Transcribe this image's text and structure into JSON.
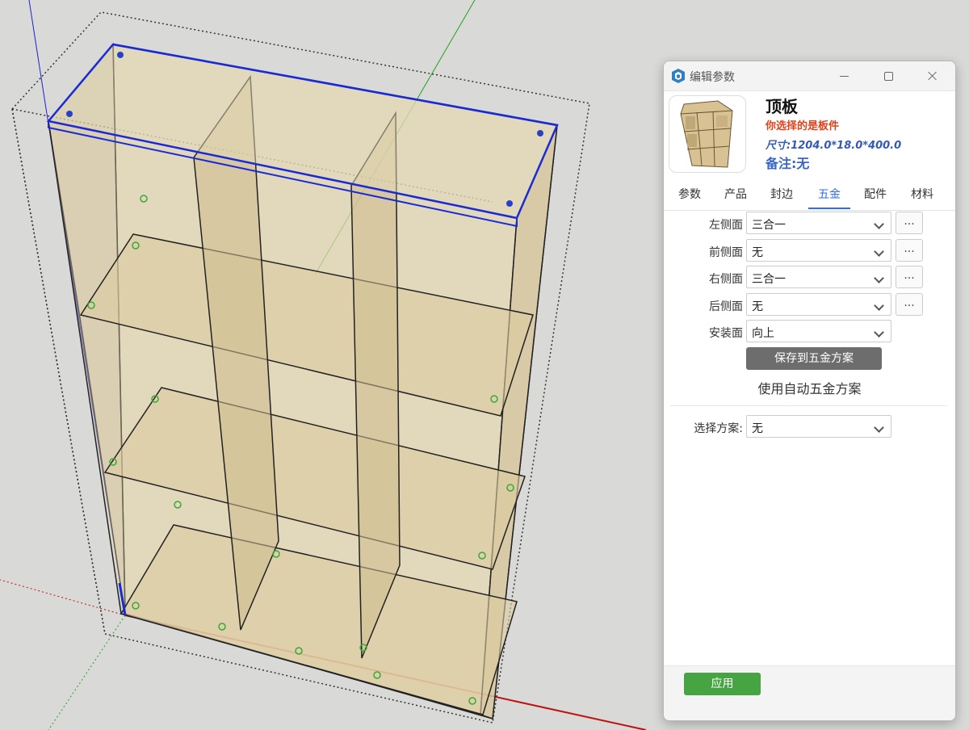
{
  "dialog": {
    "title": "编辑参数",
    "icon": "sketchup-icon",
    "window_controls": [
      "minimize-icon",
      "maximize-icon",
      "close-icon"
    ]
  },
  "info": {
    "name": "顶板",
    "subtitle": "你选择的是板件",
    "size": "尺寸:1204.0*18.0*400.0",
    "note": "备注:无"
  },
  "tabs": [
    {
      "label": "参数"
    },
    {
      "label": "产品"
    },
    {
      "label": "封边"
    },
    {
      "label": "五金",
      "active": true
    },
    {
      "label": "配件"
    },
    {
      "label": "材料"
    }
  ],
  "hardware": {
    "left": {
      "label": "左侧面",
      "value": "三合一",
      "more": "..."
    },
    "front": {
      "label": "前侧面",
      "value": "无",
      "more": "..."
    },
    "right": {
      "label": "右侧面",
      "value": "三合一",
      "more": "..."
    },
    "back": {
      "label": "后侧面",
      "value": "无",
      "more": "..."
    },
    "install": {
      "label": "安装面",
      "value": "向上"
    },
    "save_label": "保存到五金方案",
    "auto_label": "使用自动五金方案"
  },
  "scheme": {
    "label": "选择方案:",
    "value": "无"
  },
  "footer": {
    "apply_label": "应用"
  },
  "colors": {
    "accent": "#2c6ee6",
    "subtitle": "#e0421b",
    "size": "#3559b8",
    "apply": "#46a542",
    "selection": "#1a2bd6",
    "axis_red": "#c01010",
    "axis_green": "#1fa31f",
    "axis_blue": "#2222cc",
    "wood": "#d9c9a0"
  }
}
